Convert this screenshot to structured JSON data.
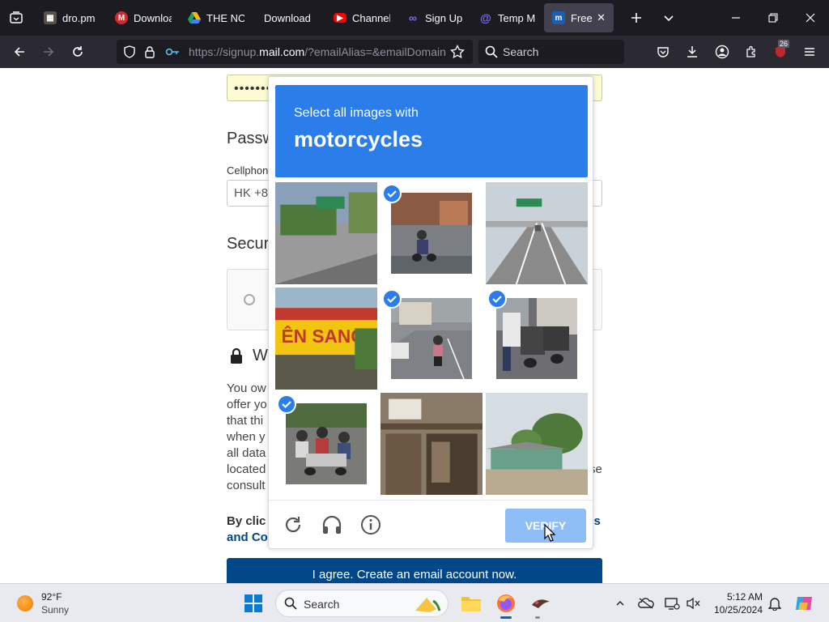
{
  "browser": {
    "tabs": [
      {
        "label": "dro.pm",
        "icon": "dro-pm-favicon",
        "color": "#4a4a4a"
      },
      {
        "label": "Downloa",
        "icon": "mega-favicon",
        "color": "#d9272e"
      },
      {
        "label": "THE NOI",
        "icon": "google-drive-favicon",
        "color": "#1fa463"
      },
      {
        "label": "Download",
        "icon": "blank-favicon",
        "color": ""
      },
      {
        "label": "Channel",
        "icon": "youtube-favicon",
        "color": "#ff0000"
      },
      {
        "label": "Sign Up",
        "icon": "sign-up-favicon",
        "color": "#7b6cf6"
      },
      {
        "label": "Temp M",
        "icon": "temp-mail-favicon",
        "color": "#7b6cf6"
      },
      {
        "label": "Free W",
        "icon": "mail-com-favicon",
        "color": "#1a5fb4"
      }
    ],
    "url_prefix": "https://signup.",
    "url_domain": "mail.com",
    "url_rest": "/?emailAlias=&emailDomain",
    "search_placeholder": "Search",
    "extension_badge": "26"
  },
  "page": {
    "password_masked": "••••••••••••••••",
    "password_heading": "Passw",
    "cellphone_label": "Cellphon",
    "phone_value": "HK +8",
    "security_heading": "Secur",
    "warning_heading": "W",
    "body_lines": [
      "You ow",
      "offer yo",
      "that thi",
      "when y",
      "all data",
      "located",
      "consult"
    ],
    "body_right_fragment": "se",
    "terms_prefix": "By clic",
    "terms_link_right": "erms",
    "terms_line2": "and Co",
    "agree_button": "I agree. Create an email account now."
  },
  "captcha": {
    "prompt_line1": "Select all images with",
    "prompt_line2": "motorcycles",
    "verify_label": "VERIFY",
    "accent_color": "#2b7de9",
    "tiles": [
      {
        "subject": "roadside-shop",
        "selected": false
      },
      {
        "subject": "motorcycle-rider-street",
        "selected": true
      },
      {
        "subject": "highway",
        "selected": false
      },
      {
        "subject": "storefront-sign",
        "selected": false
      },
      {
        "subject": "scooter-rider-road",
        "selected": true
      },
      {
        "subject": "parked-motorcycles",
        "selected": true
      },
      {
        "subject": "crowd-with-scooters",
        "selected": true
      },
      {
        "subject": "shop-front",
        "selected": false
      },
      {
        "subject": "houses-with-trees",
        "selected": false
      }
    ]
  },
  "taskbar": {
    "weather_temp": "92°F",
    "weather_desc": "Sunny",
    "search_label": "Search",
    "time": "5:12 AM",
    "date": "10/25/2024"
  }
}
